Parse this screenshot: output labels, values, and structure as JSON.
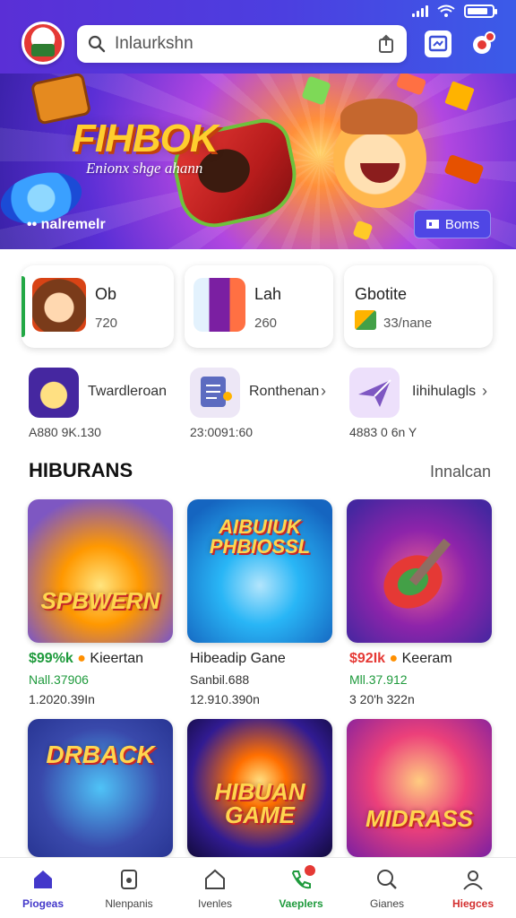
{
  "header": {
    "search_query": "Inlaurkshn"
  },
  "banner": {
    "title": "FIHBOK",
    "subtitle": "Enionx shge ahann",
    "brand": "•• nalremelr",
    "button_label": "Boms"
  },
  "quick_cards": [
    {
      "name": "Ob",
      "value": "720"
    },
    {
      "name": "Lah",
      "value": "260"
    },
    {
      "name": "Gbotite",
      "value": "33/nane"
    }
  ],
  "apps": [
    {
      "name": "Twardleroan",
      "meta": "A880 9K.130"
    },
    {
      "name": "Ronthenan",
      "meta": "23:0091:60"
    },
    {
      "name": "Iihihulagls",
      "meta": "4883 0 6n Y"
    }
  ],
  "section": {
    "title": "HIBURANS",
    "link": "Innalcan"
  },
  "games": [
    {
      "art_label": "SPBWERN",
      "badge": "$99%k",
      "badge_color": "#1e9a3c",
      "name": "Kieertan",
      "line2": "Nall.37906",
      "line3": "1.2020.39In"
    },
    {
      "art_label": "AIBUIUK PHBIOSSL",
      "badge": "",
      "badge_color": "",
      "name": "Hibeadip Gane",
      "line2": "Sanbil.688",
      "line3": "12.910.390n"
    },
    {
      "art_label": "",
      "badge": "$92Ik",
      "badge_color": "#e53935",
      "name": "Keeram",
      "line2": "Mll.37.912",
      "line3": "3 20'h 322n"
    },
    {
      "art_label": "DRBACK",
      "badge": "",
      "badge_color": "",
      "name": "",
      "line2": "",
      "line3": ""
    },
    {
      "art_label": "HIBUAN GAME",
      "badge": "",
      "badge_color": "",
      "name": "",
      "line2": "",
      "line3": ""
    },
    {
      "art_label": "MIDRASS",
      "badge": "",
      "badge_color": "",
      "name": "",
      "line2": "",
      "line3": ""
    }
  ],
  "nav": [
    {
      "label": "Piogeas",
      "icon": "home-icon",
      "state": "active"
    },
    {
      "label": "Nlenpanis",
      "icon": "document-icon",
      "state": ""
    },
    {
      "label": "Ivenles",
      "icon": "house-icon",
      "state": ""
    },
    {
      "label": "Vaeplers",
      "icon": "phone-icon",
      "state": "green"
    },
    {
      "label": "Gianes",
      "icon": "search-icon",
      "state": ""
    },
    {
      "label": "Hiegces",
      "icon": "user-icon",
      "state": "red"
    }
  ],
  "colors": {
    "header_start": "#5a2fd6",
    "header_end": "#3b5be8",
    "active_nav": "#4338ca",
    "green": "#1e9a3c",
    "red": "#e53935"
  }
}
